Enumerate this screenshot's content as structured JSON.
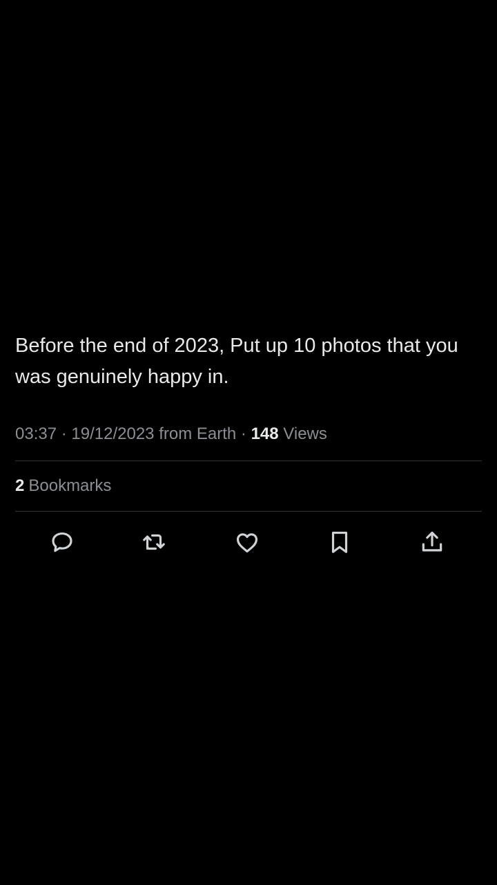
{
  "tweet": {
    "text": "Before the end of 2023, Put up 10 photos that you was genuinely happy in.",
    "time": "03:37",
    "date": "19/12/2023",
    "source": "from Earth",
    "views_count": "148",
    "views_label": "Views",
    "bookmarks_count": "2",
    "bookmarks_label": "Bookmarks",
    "separator": "·"
  },
  "actions": [
    {
      "icon": "reply-icon"
    },
    {
      "icon": "retweet-icon"
    },
    {
      "icon": "like-icon"
    },
    {
      "icon": "bookmark-icon"
    },
    {
      "icon": "share-icon"
    }
  ],
  "colors": {
    "background": "#000000",
    "primary_text": "#e7e9ea",
    "secondary_text": "#8b8f94",
    "divider": "#2f3336"
  }
}
